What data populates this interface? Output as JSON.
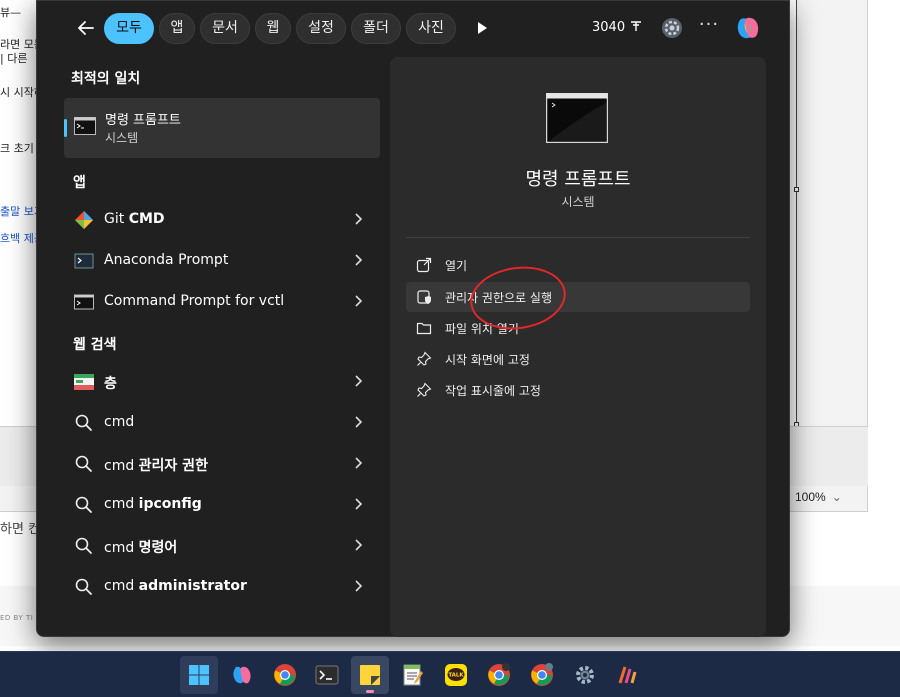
{
  "background": {
    "side_texts": [
      "뷰—",
      "라면 모든",
      "| 다른",
      "시 시작하",
      "크 초기",
      "출말 보기",
      "흐백 제공"
    ],
    "zoom": "100%",
    "page_text": "하면 컨",
    "page_tiny": "ED BY TI"
  },
  "start_menu": {
    "filters": [
      {
        "label": "모두",
        "active": true
      },
      {
        "label": "앱",
        "active": false
      },
      {
        "label": "문서",
        "active": false
      },
      {
        "label": "웹",
        "active": false
      },
      {
        "label": "설정",
        "active": false
      },
      {
        "label": "폴더",
        "active": false
      },
      {
        "label": "사진",
        "active": false
      }
    ],
    "weather_text": "3040",
    "best_match": {
      "section": "최적의 일치",
      "title": "명령 프롬프트",
      "subtitle": "시스템"
    },
    "apps": {
      "section": "앱",
      "items": [
        {
          "pre": "Git ",
          "bold": "CMD",
          "icon": "git-cmd-icon"
        },
        {
          "pre": "Anaconda Prompt",
          "bold": "",
          "icon": "anaconda-prompt-icon"
        },
        {
          "pre": "Command Prompt for vctl",
          "bold": "",
          "icon": "command-prompt-icon"
        }
      ]
    },
    "web": {
      "section": "웹 검색",
      "items": [
        {
          "pre": "",
          "bold": "층",
          "icon": "web-thumbnail-icon"
        },
        {
          "pre": "cmd",
          "bold": "",
          "icon": "search-icon"
        },
        {
          "pre": "cmd ",
          "bold": "관리자 권한",
          "icon": "search-icon"
        },
        {
          "pre": "cmd ",
          "bold": "ipconfig",
          "icon": "search-icon"
        },
        {
          "pre": "cmd ",
          "bold": "명령어",
          "icon": "search-icon"
        },
        {
          "pre": "cmd ",
          "bold": "administrator",
          "icon": "search-icon"
        }
      ]
    },
    "preview": {
      "name": "명령 프롬프트",
      "kind": "시스템",
      "actions": [
        {
          "label": "열기",
          "icon": "open-external-icon",
          "highlight": false
        },
        {
          "label": "관리자 권한으로 실행",
          "icon": "run-as-admin-icon",
          "highlight": true
        },
        {
          "label": "파일 위치 열기",
          "icon": "folder-icon",
          "highlight": false
        },
        {
          "label": "시작 화면에 고정",
          "icon": "pin-icon",
          "highlight": false
        },
        {
          "label": "작업 표시줄에 고정",
          "icon": "pin-icon",
          "highlight": false
        }
      ]
    }
  },
  "taskbar": {
    "items": [
      "start-icon",
      "copilot-icon",
      "chrome-icon",
      "terminal-icon",
      "sticky-notes-icon",
      "notepad-icon",
      "kakaotalk-icon",
      "chrome-profile-icon",
      "chrome-profile2-icon",
      "settings-icon",
      "app-icon"
    ],
    "kakao_label": "TALK"
  },
  "colors": {
    "accent": "#4cc2ff",
    "menu_bg": "#202020",
    "preview_bg": "#2b2b2b",
    "annotation": "#e0282a",
    "taskbar_bg": "#1d2a45"
  }
}
